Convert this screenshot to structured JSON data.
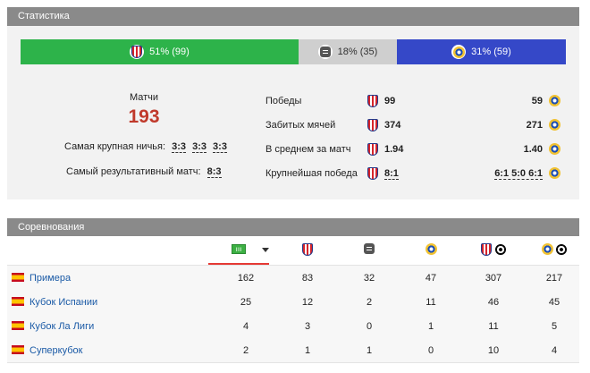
{
  "stats": {
    "title": "Статистика",
    "ratio": {
      "win1": "51% (99)",
      "draw": "18% (35)",
      "win2": "31% (59)",
      "win1_fraction": 0.51,
      "draw_fraction": 0.18,
      "win2_fraction": 0.31
    },
    "matches_label": "Матчи",
    "matches_value": "193",
    "biggest_draw_label": "Самая крупная ничья:",
    "biggest_draw_values": [
      "3:3",
      "3:3",
      "3:3"
    ],
    "most_goals_label": "Самый результативный матч:",
    "most_goals_value": "8:3",
    "rows": [
      {
        "label": "Победы",
        "left": "99",
        "right": "59"
      },
      {
        "label": "Забитых мячей",
        "left": "374",
        "right": "271"
      },
      {
        "label": "В среднем за матч",
        "left": "1.94",
        "right": "1.40"
      },
      {
        "label": "Крупнейшая победа",
        "left": "8:1",
        "right": "6:1 5:0 6:1"
      }
    ]
  },
  "competitions": {
    "title": "Соревнования",
    "rows": [
      {
        "name": "Примера",
        "values": [
          "162",
          "83",
          "32",
          "47",
          "307",
          "217"
        ]
      },
      {
        "name": "Кубок Испании",
        "values": [
          "25",
          "12",
          "2",
          "11",
          "46",
          "45"
        ]
      },
      {
        "name": "Кубок Ла Лиги",
        "values": [
          "4",
          "3",
          "0",
          "1",
          "11",
          "5"
        ]
      },
      {
        "name": "Суперкубок",
        "values": [
          "2",
          "1",
          "1",
          "0",
          "10",
          "4"
        ]
      }
    ]
  },
  "colors": {
    "win1": "#2db34a",
    "draw": "#cfcfcf",
    "win2": "#3548c8",
    "accent": "#c0392b",
    "link": "#1a5aa6"
  }
}
